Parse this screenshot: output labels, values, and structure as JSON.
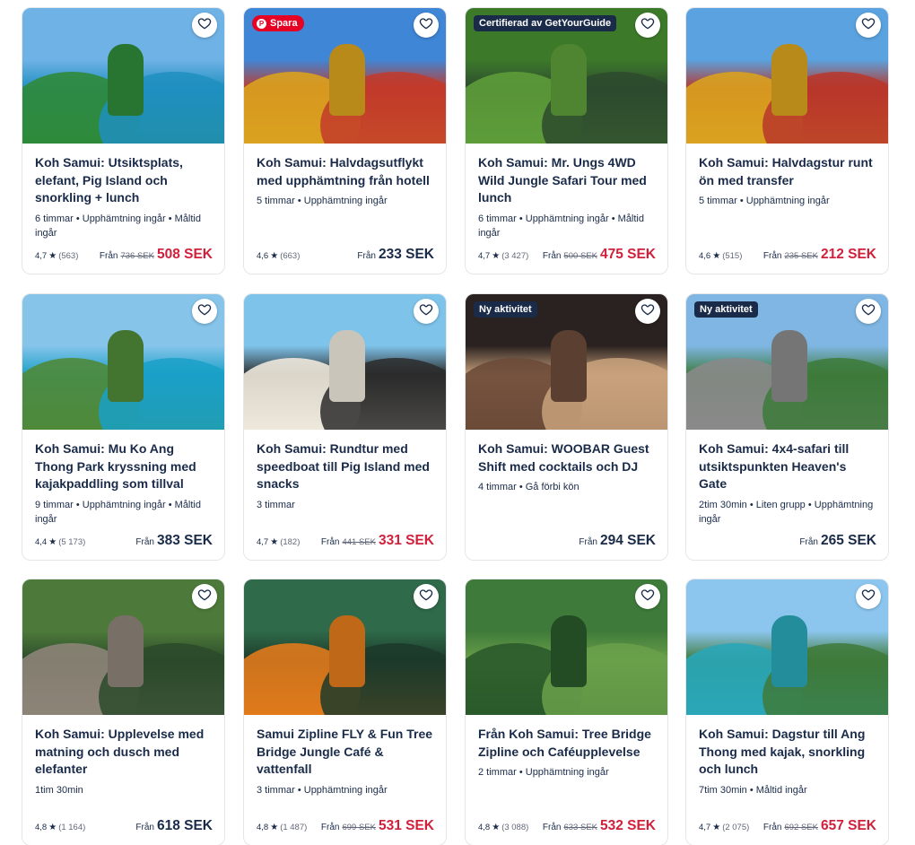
{
  "cards": [
    {
      "title": "Koh Samui: Utsiktsplats, elefant, Pig Island och snorkling + lunch",
      "meta": "6 timmar • Upphämtning ingår • Måltid ingår",
      "rating": "4,7",
      "reviews": "(563)",
      "from_label": "Från",
      "old_price": "736 SEK",
      "price": "508 SEK",
      "sale": true,
      "badge": "",
      "image": "hilltop couple with stone hand and sea bay",
      "colors": [
        "#6fb2e6",
        "#2f8a3a",
        "#1f8fbf"
      ]
    },
    {
      "title": "Koh Samui: Halvdagsutflykt med upphämtning från hotell",
      "meta": "5 timmar • Upphämtning ingår",
      "rating": "4,6",
      "reviews": "(663)",
      "from_label": "Från",
      "old_price": "",
      "price": "233 SEK",
      "sale": false,
      "badge": "Spara",
      "badge_type": "pin",
      "image": "golden big buddha statue",
      "colors": [
        "#3f86d6",
        "#d9a21f",
        "#c23a2a"
      ]
    },
    {
      "title": "Koh Samui: Mr. Ungs 4WD Wild Jungle Safari Tour med lunch",
      "meta": "6 timmar • Upphämtning ingår • Måltid ingår",
      "rating": "4,7",
      "reviews": "(3 427)",
      "from_label": "Från",
      "old_price": "500 SEK",
      "price": "475 SEK",
      "sale": true,
      "badge": "Certifierad av GetYourGuide",
      "badge_type": "dark",
      "image": "group of tourists in jungle jeep",
      "colors": [
        "#3c7a2a",
        "#5d9c3a",
        "#2d4a2e"
      ]
    },
    {
      "title": "Koh Samui: Halvdagstur runt ön med transfer",
      "meta": "5 timmar • Upphämtning ingår",
      "rating": "4,6",
      "reviews": "(515)",
      "from_label": "Från",
      "old_price": "235 SEK",
      "price": "212 SEK",
      "sale": true,
      "badge": "",
      "image": "big buddha with cloudy blue sky",
      "colors": [
        "#5aa3e0",
        "#d9a21f",
        "#b8362a"
      ]
    },
    {
      "title": "Koh Samui: Mu Ko Ang Thong Park kryssning med kajakpaddling som tillval",
      "meta": "9 timmar • Upphämtning ingår • Måltid ingår",
      "rating": "4,4",
      "reviews": "(5 173)",
      "from_label": "Från",
      "old_price": "",
      "price": "383 SEK",
      "sale": false,
      "badge": "",
      "image": "wooden cruise boat near cliff island",
      "colors": [
        "#86c4ea",
        "#4f8a3a",
        "#1aa0c8"
      ]
    },
    {
      "title": "Koh Samui: Rundtur med speedboat till Pig Island med snacks",
      "meta": "3 timmar",
      "rating": "4,7",
      "reviews": "(182)",
      "from_label": "Från",
      "old_price": "441 SEK",
      "price": "331 SEK",
      "sale": true,
      "badge": "",
      "image": "black pig on white sand beach",
      "colors": [
        "#7ec3ea",
        "#eee8dc",
        "#2b2b2b"
      ]
    },
    {
      "title": "Koh Samui: WOOBAR Guest Shift med cocktails och DJ",
      "meta": "4 timmar • Gå förbi kön",
      "rating": "",
      "reviews": "",
      "from_label": "Från",
      "old_price": "",
      "price": "294 SEK",
      "sale": false,
      "badge": "Ny aktivitet",
      "badge_type": "dark",
      "image": "dj in patterned shirt at bar",
      "colors": [
        "#2a2220",
        "#6b4a38",
        "#c9a27c"
      ]
    },
    {
      "title": "Koh Samui: 4x4-safari till utsiktspunkten Heaven's Gate",
      "meta": "2tim 30min • Liten grupp • Upphämtning ingår",
      "rating": "",
      "reviews": "",
      "from_label": "Från",
      "old_price": "",
      "price": "265 SEK",
      "sale": false,
      "badge": "Ny aktivitet",
      "badge_type": "dark",
      "image": "woman on giant stone hand viewpoint",
      "colors": [
        "#7fb6e3",
        "#8a8a8a",
        "#3d7a3a"
      ]
    },
    {
      "title": "Koh Samui: Upplevelse med matning och dusch med elefanter",
      "meta": "1tim 30min",
      "rating": "4,8",
      "reviews": "(1 164)",
      "from_label": "Från",
      "old_price": "",
      "price": "618 SEK",
      "sale": false,
      "badge": "",
      "image": "woman washing elephant",
      "colors": [
        "#4d7a3a",
        "#8d8478",
        "#2c4a2a"
      ]
    },
    {
      "title": "Samui Zipline FLY & Fun Tree Bridge Jungle Café & vattenfall",
      "meta": "3 timmar • Upphämtning ingår",
      "rating": "4,8",
      "reviews": "(1 487)",
      "from_label": "Från",
      "old_price": "699 SEK",
      "price": "531 SEK",
      "sale": true,
      "badge": "",
      "image": "people on zipline in orange helmets",
      "colors": [
        "#2f6a4a",
        "#e07a1c",
        "#1c3a2a"
      ]
    },
    {
      "title": "Från Koh Samui: Tree Bridge Zipline och Caféupplevelse",
      "meta": "2 timmar • Upphämtning ingår",
      "rating": "4,8",
      "reviews": "(3 088)",
      "from_label": "Från",
      "old_price": "633 SEK",
      "price": "532 SEK",
      "sale": true,
      "badge": "",
      "image": "person ziplining over jungle canopy",
      "colors": [
        "#3e7a3a",
        "#2a5a2a",
        "#6aa04a"
      ]
    },
    {
      "title": "Koh Samui: Dagstur till Ang Thong med kajak, snorkling och lunch",
      "meta": "7tim 30min • Måltid ingår",
      "rating": "4,7",
      "reviews": "(2 075)",
      "from_label": "Från",
      "old_price": "692 SEK",
      "price": "657 SEK",
      "sale": true,
      "badge": "",
      "image": "woman with raised arms over island bay",
      "colors": [
        "#8cc6ef",
        "#2aa6b8",
        "#3e7a3a"
      ]
    }
  ]
}
